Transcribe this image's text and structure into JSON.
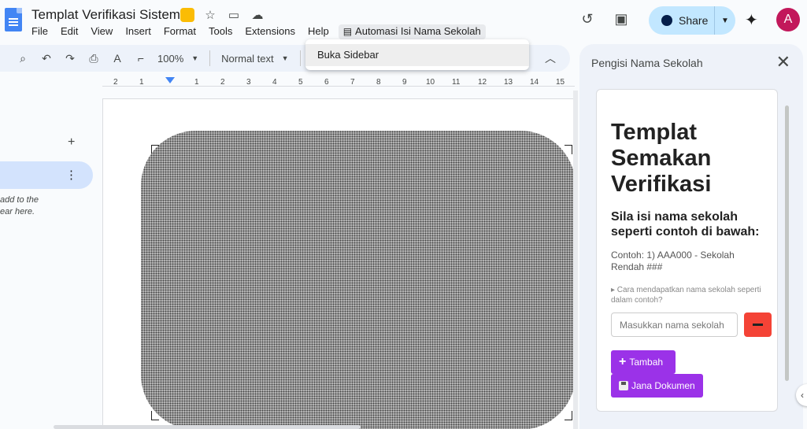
{
  "doc": {
    "title": "Templat Verifikasi Sistem"
  },
  "menu": {
    "file": "File",
    "edit": "Edit",
    "view": "View",
    "insert": "Insert",
    "format": "Format",
    "tools": "Tools",
    "extensions": "Extensions",
    "help": "Help",
    "addon": "Automasi Isi Nama Sekolah"
  },
  "dropdown": {
    "item": "Buka Sidebar"
  },
  "toolbar": {
    "zoom": "100%",
    "style": "Normal text",
    "font_partial": "A"
  },
  "header": {
    "share_label": "Share",
    "avatar_letter": "A"
  },
  "ruler": {
    "ticks": [
      "2",
      "1",
      "1",
      "2",
      "3",
      "4",
      "5",
      "6",
      "7",
      "8",
      "9",
      "10",
      "11",
      "12",
      "13",
      "14",
      "15"
    ]
  },
  "outline": {
    "hint_line1": "add to the",
    "hint_line2": "ear here."
  },
  "sidebar": {
    "title": "Pengisi Nama Sekolah",
    "heading_line1": "Templat",
    "heading_line2": "Semakan",
    "heading_line3": "Verifikasi",
    "subheading": "Sila isi nama sekolah seperti contoh di bawah:",
    "example": "Contoh: 1) AAA000 - Sekolah Rendah ###",
    "help": "▸ Cara mendapatkan nama sekolah seperti dalam contoh?",
    "input_placeholder": "Masukkan nama sekolah",
    "add_label": "Tambah",
    "save_label": "Jana Dokumen"
  },
  "colors": {
    "accent_button": "#9b32e8",
    "remove_button": "#f44336",
    "share_bg": "#c2e7ff",
    "avatar_bg": "#c2185b"
  }
}
